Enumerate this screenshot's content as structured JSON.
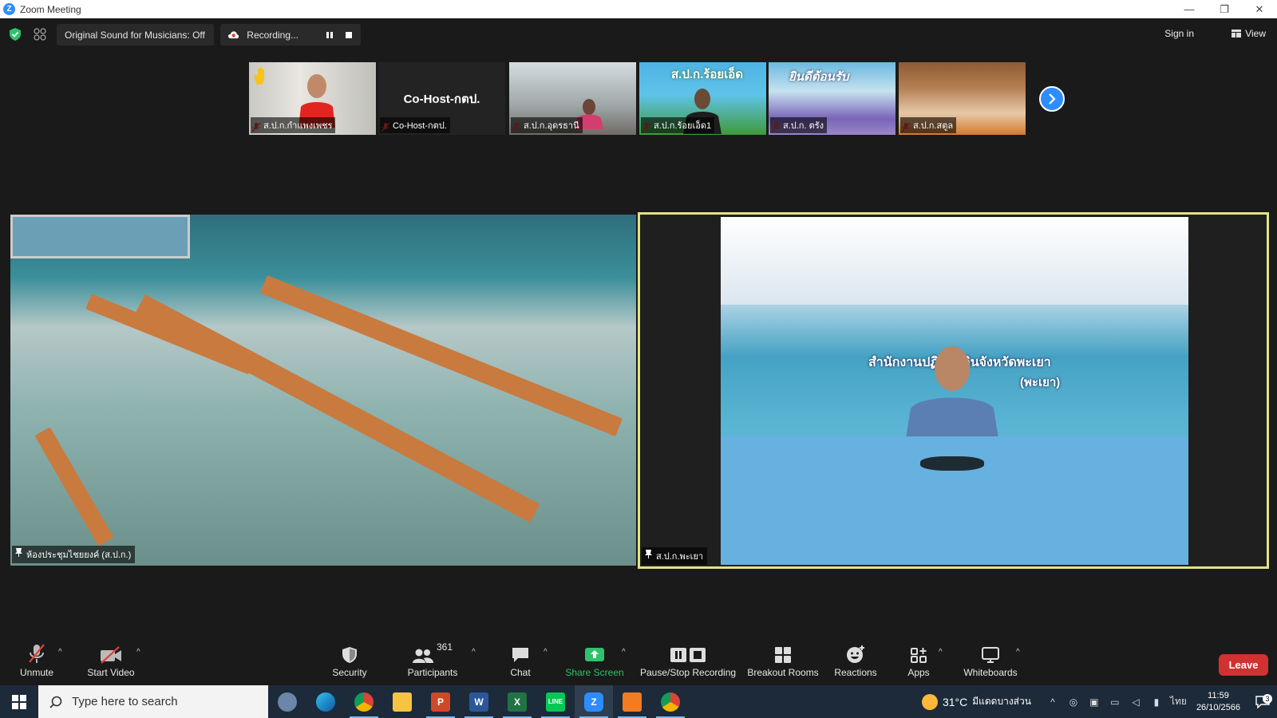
{
  "window": {
    "title": "Zoom Meeting",
    "minimize": "—",
    "restore": "❐",
    "close": "✕"
  },
  "topbar": {
    "sound_label": "Original Sound for Musicians: Off",
    "recording_label": "Recording...",
    "signin_label": "Sign in",
    "view_label": "View"
  },
  "filmstrip": [
    {
      "name": "ส.ป.ก.กำแพงเพชร",
      "hand_raised": true
    },
    {
      "name": "Co-Host-กตป.",
      "display_text": "Co-Host-กตป."
    },
    {
      "name": "ส.ป.ก.อุดรธานี"
    },
    {
      "name": "ส.ป.ก.ร้อยเอ็ด1",
      "banner": "ส.ป.ก.ร้อยเอ็ด"
    },
    {
      "name": "ส.ป.ก. ตรัง",
      "banner": "ยินดีต้อนรับ"
    },
    {
      "name": "ส.ป.ก.สตูล"
    }
  ],
  "main_videos": {
    "left": {
      "name": "ห้องประชุมไชยยงค์ (ส.ป.ก.)"
    },
    "right": {
      "name": "ส.ป.ก.พะเยา",
      "backdrop_text": "สำนักงานปฏิรูปที่ดินจังหวัดพะเยา",
      "backdrop_sub": "(พะเยา)"
    }
  },
  "toolbar": {
    "unmute": "Unmute",
    "start_video": "Start Video",
    "security": "Security",
    "participants": "Participants",
    "participants_count": "361",
    "chat": "Chat",
    "share_screen": "Share Screen",
    "pause_stop_recording": "Pause/Stop Recording",
    "breakout_rooms": "Breakout Rooms",
    "reactions": "Reactions",
    "apps": "Apps",
    "whiteboards": "Whiteboards",
    "leave": "Leave"
  },
  "taskbar": {
    "search_placeholder": "Type here to search",
    "weather_temp": "31°C",
    "weather_text": "มีแดดบางส่วน",
    "language": "ไทย",
    "time": "11:59",
    "date": "26/10/2566",
    "notification_count": "3"
  },
  "colors": {
    "accent": "#2d8cff",
    "active_speaker_border": "#e2e286",
    "leave": "#d13131",
    "share": "#2ec36a",
    "mic_off": "#e0413a"
  }
}
